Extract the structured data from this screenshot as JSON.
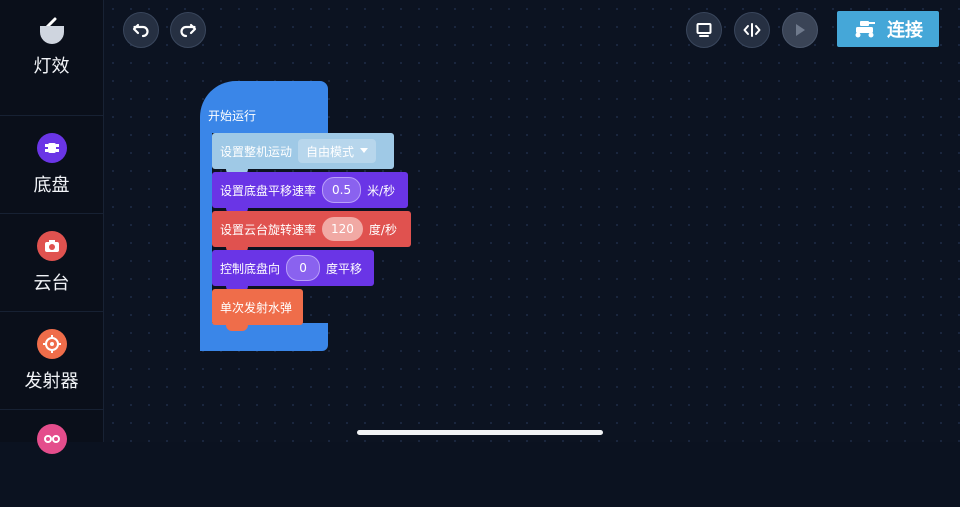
{
  "sidebar": {
    "back_icon": "chevron-left-icon",
    "items": [
      {
        "label": "灯效",
        "icon": "light-effect-icon",
        "color": "#cfd5df"
      },
      {
        "label": "底盘",
        "icon": "chassis-icon",
        "color": "#6a35e6"
      },
      {
        "label": "云台",
        "icon": "gimbal-camera-icon",
        "color": "#e0524f"
      },
      {
        "label": "发射器",
        "icon": "blaster-target-icon",
        "color": "#ef6d4a"
      },
      {
        "label": "",
        "icon": "sensor-icon",
        "color": "#e44d8c"
      }
    ]
  },
  "toolbar": {
    "undo_icon": "undo-icon",
    "redo_icon": "redo-icon",
    "monitor_icon": "monitor-icon",
    "code_icon": "code-toggle-icon",
    "play_icon": "play-icon",
    "connect_label": "连接",
    "connect_color": "#45a7d8"
  },
  "script": {
    "start_label": "开始运行",
    "blocks": [
      {
        "prefix": "设置整机运动",
        "dropdown": "自由模式",
        "suffix": "",
        "color": "#9fc9e6"
      },
      {
        "prefix": "设置底盘平移速率",
        "value": "0.5",
        "suffix": "米/秒",
        "color": "#6a35e6"
      },
      {
        "prefix": "设置云台旋转速率",
        "value": "120",
        "suffix": "度/秒",
        "color": "#e0524f"
      },
      {
        "prefix": "控制底盘向",
        "value": "0",
        "suffix": "度平移",
        "color": "#6a35e6"
      },
      {
        "prefix": "单次发射水弹",
        "suffix": "",
        "color": "#ef6d4a"
      }
    ]
  }
}
